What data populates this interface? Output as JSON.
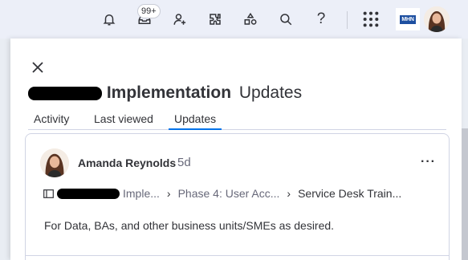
{
  "topbar": {
    "notifications_icon": "bell-icon",
    "inbox_icon": "inbox-icon",
    "inbox_badge": "99+",
    "invite_icon": "invite-members-icon",
    "apps_icon": "puzzle-icon",
    "templates_icon": "shapes-icon",
    "search_icon": "search-icon",
    "help_icon": "help-icon",
    "help_glyph": "?",
    "launcher_icon": "grid-icon",
    "brand_text": "MHN"
  },
  "panel": {
    "title_bold": "Implementation",
    "title_suffix": "Updates",
    "tabs": [
      {
        "label": "Activity"
      },
      {
        "label": "Last viewed"
      },
      {
        "label": "Updates"
      }
    ],
    "active_tab": "Updates"
  },
  "update": {
    "author": "Amanda Reynolds",
    "time": "5d",
    "more_glyph": "···",
    "breadcrumb": {
      "item_1_suffix": "Imple...",
      "item_2": "Phase 4: User Acc...",
      "item_3": "Service Desk Train..."
    },
    "body": "For Data, BAs, and other business units/SMEs as desired."
  }
}
